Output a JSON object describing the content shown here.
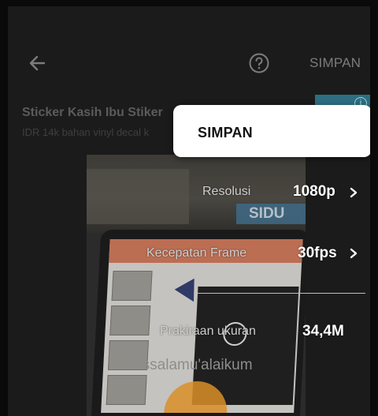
{
  "topbar": {
    "back_icon": "arrow-left-icon",
    "help_icon": "question-circle-icon",
    "save_label": "SIMPAN"
  },
  "ad": {
    "title": "Sticker Kasih Ibu Stiker",
    "subtitle": "IDR 14k bahan vinyl decal k",
    "info_icon": "info-icon"
  },
  "preview": {
    "sign_text": "SIDU",
    "caption": "Assalamu'alaikum"
  },
  "settings": {
    "resolution": {
      "label": "Resolusi",
      "value": "1080p"
    },
    "frame_rate": {
      "label": "Kecepatan Frame",
      "value": "30fps"
    },
    "estimated_size": {
      "label": "Prakiraan ukuran",
      "value": "34,4M"
    }
  },
  "menu": {
    "items": [
      {
        "label": "SIMPAN"
      }
    ]
  },
  "colors": {
    "background": "#1b1b1b",
    "popup": "#ffffff",
    "muted_text": "#7c7c7c"
  }
}
